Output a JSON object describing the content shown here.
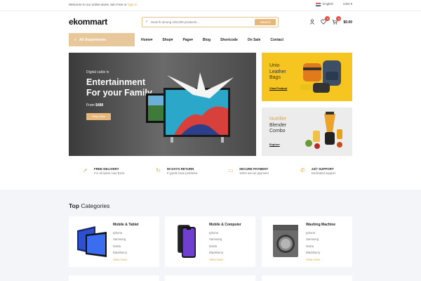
{
  "topbar": {
    "welcome": "Welcome to our online store! Join Free or",
    "signin": "Sign In",
    "language": "English",
    "currency": "USD"
  },
  "header": {
    "logo": "ekommart",
    "search_placeholder": "Search among 100,000 products...",
    "search_button": "Search",
    "wishlist_count": "0",
    "cart_count": "0",
    "cart_total": "$0.00"
  },
  "nav": {
    "all_departments": "All Departments",
    "items": [
      "Home",
      "Shop",
      "Page",
      "Blog",
      "Shortcode",
      "On Sale",
      "Contact"
    ]
  },
  "hero": {
    "subtitle": "Digital cable tv",
    "title_line1": "Entertainment",
    "title_line2": "For your Family",
    "from_label": "From",
    "price": "$488",
    "button": "Shop Now"
  },
  "promos": [
    {
      "title_lines": [
        "Unio",
        "Leather",
        "Bags"
      ],
      "link": "View Product",
      "bg": "#f7c520"
    },
    {
      "title_lines": [
        "Nutrillet",
        "Blender",
        "Combo"
      ],
      "link": "Explore",
      "bg": "#ececec",
      "accent": "#e0a44a"
    }
  ],
  "features": [
    {
      "icon": "rocket-icon",
      "title": "FREE DELIVERY",
      "desc": "For all oders over $120"
    },
    {
      "icon": "refresh-icon",
      "title": "90 DAYS RETURN",
      "desc": "If goods have problems"
    },
    {
      "icon": "card-icon",
      "title": "SECURE PAYMENT",
      "desc": "100% secure payment"
    },
    {
      "icon": "chat-icon",
      "title": "24/7 SUPPORT",
      "desc": "Dedicated support"
    }
  ],
  "categories": {
    "title_bold": "Top",
    "title_rest": "Categories",
    "cards": [
      {
        "name": "Mobile & Tablet",
        "items": [
          "Iphone",
          "Samsung",
          "Nokia",
          "Blackberry"
        ],
        "more": "View more"
      },
      {
        "name": "Mobile & Computer",
        "items": [
          "Iphone",
          "Samsung",
          "Nokia",
          "Blackberry"
        ],
        "more": "View more"
      },
      {
        "name": "Washing Machine",
        "items": [
          "Iphone",
          "Samsung",
          "Nokia",
          "Blackberry"
        ],
        "more": "View more"
      }
    ]
  },
  "colors": {
    "accent": "#e8b87a",
    "brand_yellow": "#f7c520",
    "badge": "#e74c3c"
  }
}
